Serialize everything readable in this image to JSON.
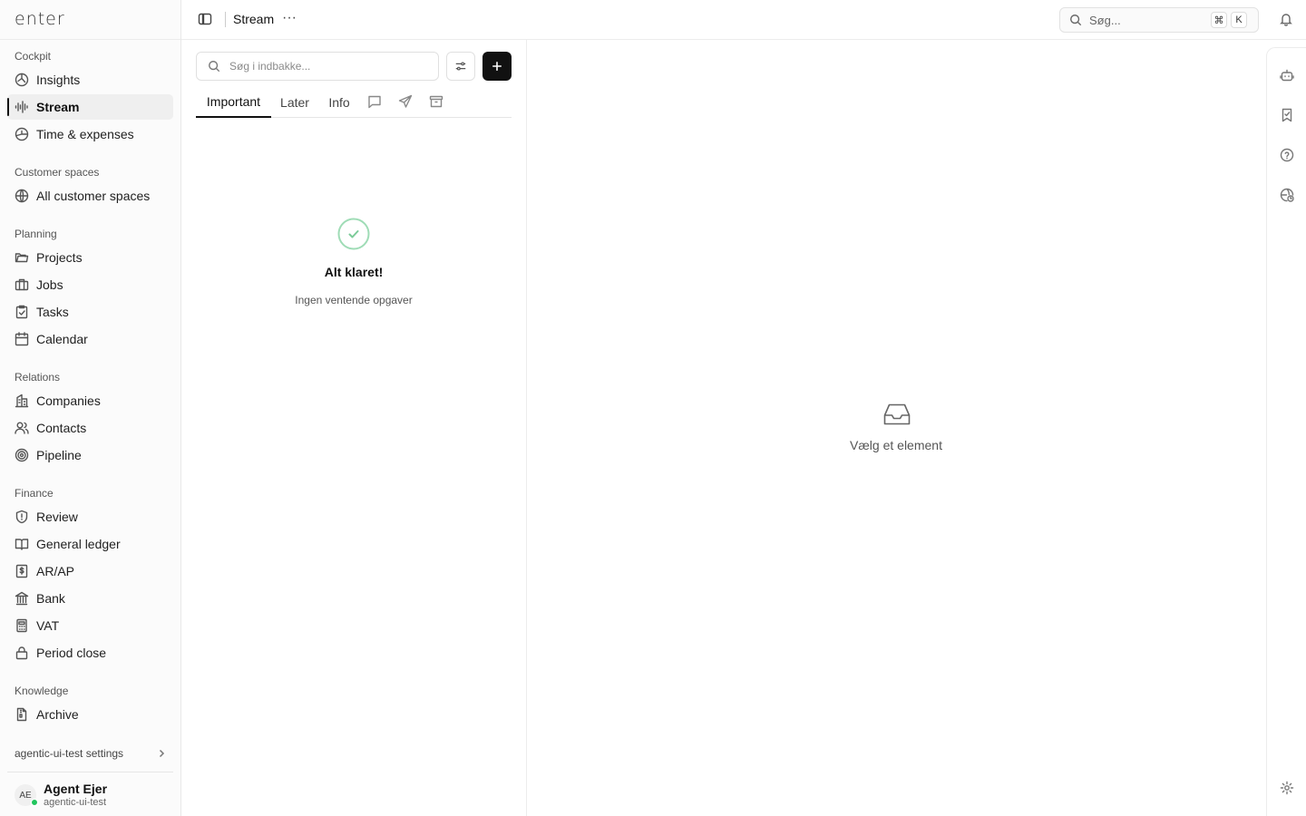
{
  "app": {
    "logo": "enter"
  },
  "header": {
    "title": "Stream",
    "more_label": "···",
    "search_placeholder": "Søg...",
    "shortcut_keys": [
      "⌘",
      "K"
    ]
  },
  "sidebar": {
    "sections": [
      {
        "label": "Cockpit",
        "items": [
          {
            "label": "Insights",
            "icon": "insights-icon"
          },
          {
            "label": "Stream",
            "icon": "stream-icon",
            "active": true
          },
          {
            "label": "Time & expenses",
            "icon": "time-expenses-icon"
          }
        ]
      },
      {
        "label": "Customer spaces",
        "items": [
          {
            "label": "All customer spaces",
            "icon": "globe-icon"
          }
        ]
      },
      {
        "label": "Planning",
        "items": [
          {
            "label": "Projects",
            "icon": "folder-icon"
          },
          {
            "label": "Jobs",
            "icon": "briefcase-icon"
          },
          {
            "label": "Tasks",
            "icon": "clipboard-check-icon"
          },
          {
            "label": "Calendar",
            "icon": "calendar-icon"
          }
        ]
      },
      {
        "label": "Relations",
        "items": [
          {
            "label": "Companies",
            "icon": "building-icon"
          },
          {
            "label": "Contacts",
            "icon": "users-icon"
          },
          {
            "label": "Pipeline",
            "icon": "target-icon"
          }
        ]
      },
      {
        "label": "Finance",
        "items": [
          {
            "label": "Review",
            "icon": "shield-alert-icon"
          },
          {
            "label": "General ledger",
            "icon": "book-open-icon"
          },
          {
            "label": "AR/AP",
            "icon": "receipt-dollar-icon"
          },
          {
            "label": "Bank",
            "icon": "bank-icon"
          },
          {
            "label": "VAT",
            "icon": "calculator-icon"
          },
          {
            "label": "Period close",
            "icon": "lock-icon"
          }
        ]
      },
      {
        "label": "Knowledge",
        "items": [
          {
            "label": "Archive",
            "icon": "file-archive-icon"
          }
        ]
      }
    ],
    "settings_label": "agentic-ui-test settings",
    "user": {
      "initials": "AE",
      "name": "Agent Ejer",
      "org": "agentic-ui-test",
      "status_color": "#22c55e"
    }
  },
  "inbox": {
    "search_placeholder": "Søg i indbakke...",
    "tabs": [
      "Important",
      "Later",
      "Info"
    ],
    "active_tab": "Important",
    "tab_icons": [
      "message-icon",
      "send-icon",
      "archive-icon"
    ],
    "empty_title": "Alt klaret!",
    "empty_subtitle": "Ingen ventende opgaver",
    "check_color": "#86d3a4"
  },
  "detail": {
    "empty_icon": "inbox-tray-icon",
    "empty_text": "Vælg et element"
  },
  "right_rail": {
    "icons": [
      "bot-icon",
      "bookmark-icon",
      "help-icon",
      "globe-clock-icon",
      "settings-gear-icon"
    ]
  }
}
